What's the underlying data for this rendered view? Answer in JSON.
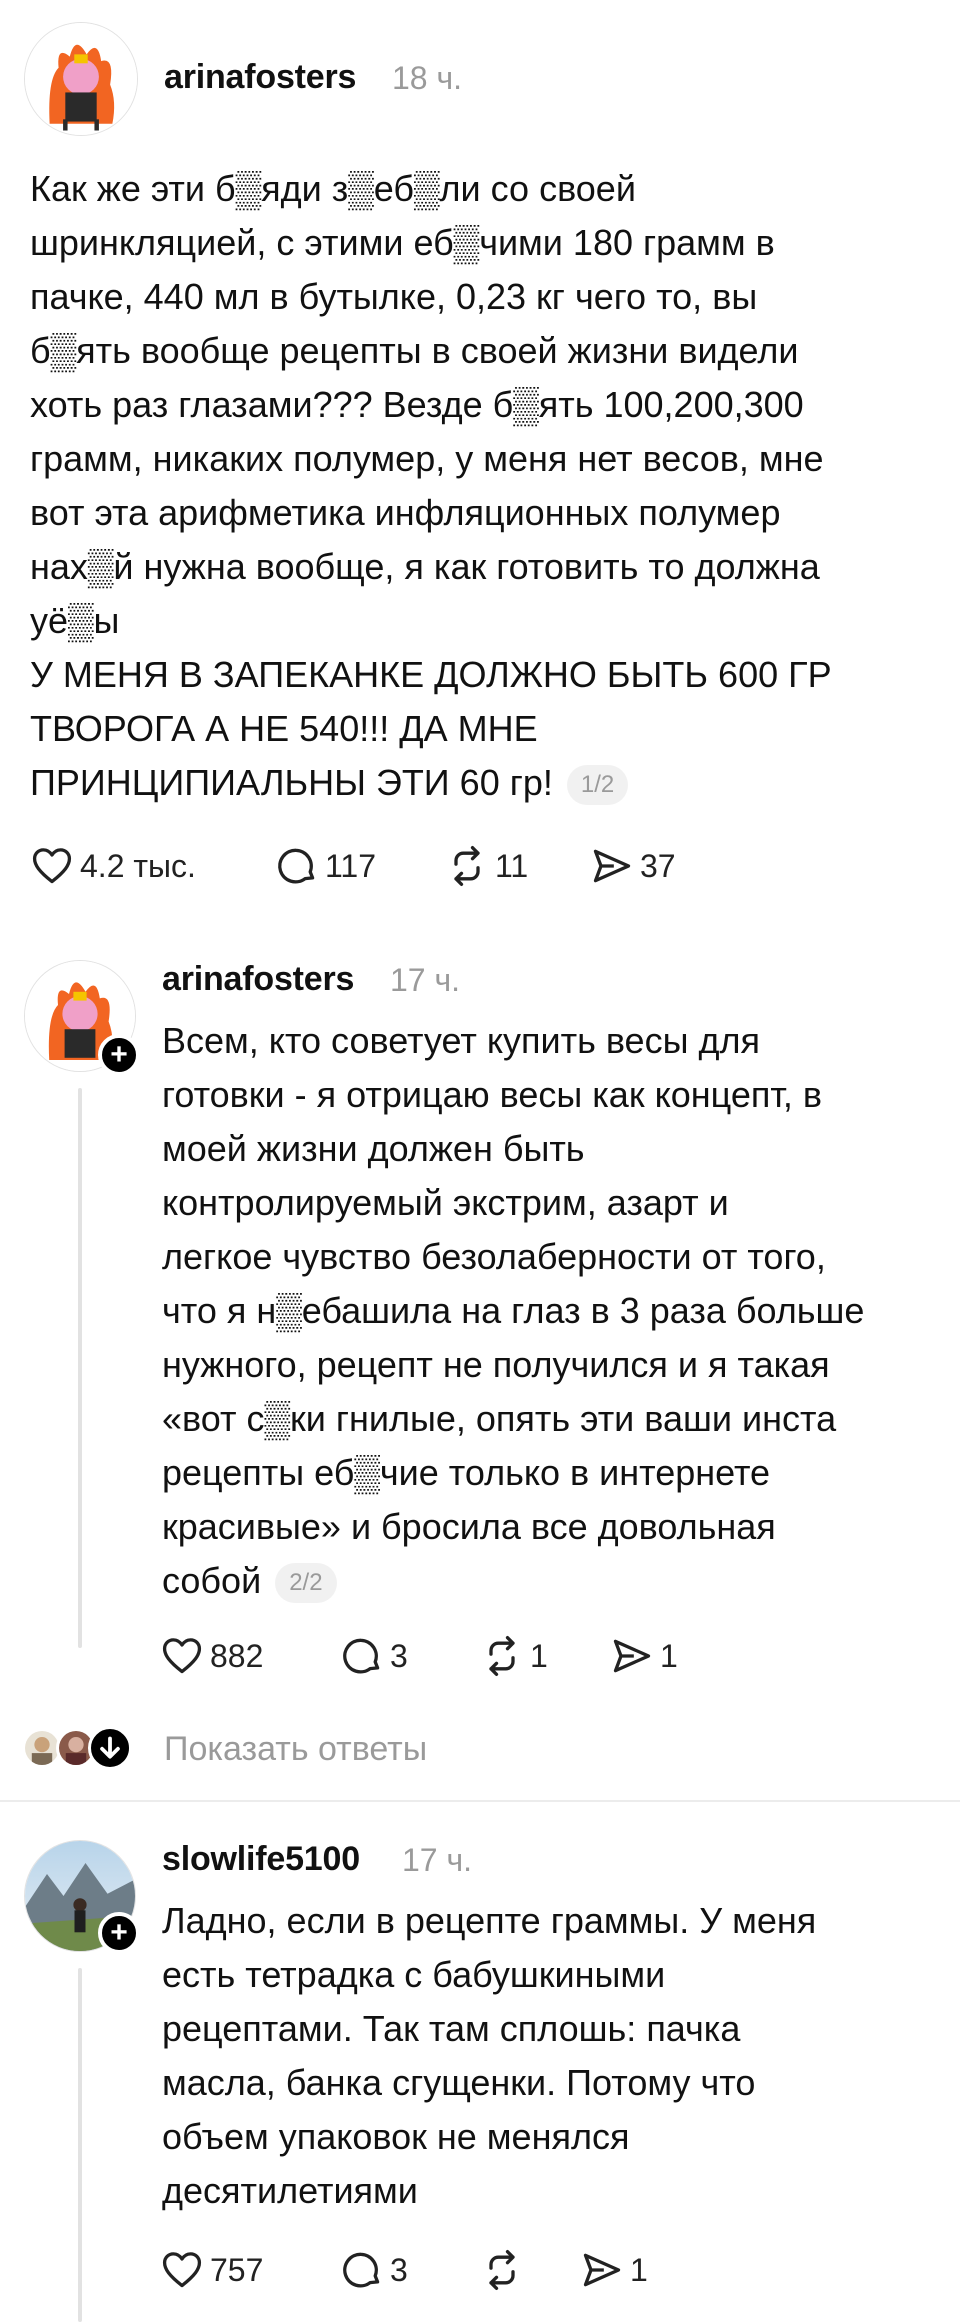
{
  "posts": [
    {
      "username": "arinafosters",
      "time": "18 ч.",
      "text": "Как же эти б▒яди з▒еб▒ли со своей\nшринкляцией, с этими еб▒чими 180 грамм в\nпачке, 440 мл в бутылке, 0,23 кг чего то, вы\nб▒ять вообще рецепты в своей жизни видели\nхоть раз глазами??? Везде б▒ять 100,200,300\nграмм, никаких полумер, у меня нет весов, мне\nвот эта арифметика инфляционных полумер\nнах▒й нужна вообще, я как готовить то должна\nуё▒ы\nУ МЕНЯ В ЗАПЕКАНКЕ ДОЛЖНО БЫТЬ 600 ГР\nТВОРОГА А НЕ 540!!! ДА МНЕ\nПРИНЦИПИАЛЬНЫ ЭТИ 60 гр!",
      "page": "1/2",
      "likes": "4.2 тыс.",
      "comments": "117",
      "reposts": "11",
      "shares": "37"
    },
    {
      "username": "arinafosters",
      "time": "17 ч.",
      "text": "Всем, кто советует купить весы для\nготовки - я отрицаю весы как концепт, в\nмоей жизни должен быть\nконтролируемый экстрим, азарт и\nлегкое чувство безолаберности от того,\nчто я н▒ебашила на глаз в 3 раза больше\nнужного, рецепт не получился и я такая\n«вот с▒ки гнилые, опять эти ваши инста\nрецепты еб▒чие только в интернете\nкрасивые» и бросила все довольная\nсобой",
      "page": "2/2",
      "likes": "882",
      "comments": "3",
      "reposts": "1",
      "shares": "1"
    },
    {
      "username": "slowlife5100",
      "time": "17 ч.",
      "text": "Ладно, если в рецепте граммы. У меня\nесть тетрадка с бабушкиными\nрецептами. Так там сплошь: пачка\nмасла, банка сгущенки. Потому что\nобъем упаковок не менялся\nдесятилетиями",
      "likes": "757",
      "comments": "3",
      "reposts": "",
      "shares": "1"
    }
  ],
  "show_replies": "Показать ответы",
  "colors": {
    "text": "#111111",
    "muted": "#9a9a9a",
    "divider": "#ececec",
    "avatar_orange": "#f26522"
  },
  "icons": [
    "heart-icon",
    "comment-icon",
    "repost-icon",
    "share-icon",
    "plus-icon",
    "arrow-down-icon"
  ]
}
